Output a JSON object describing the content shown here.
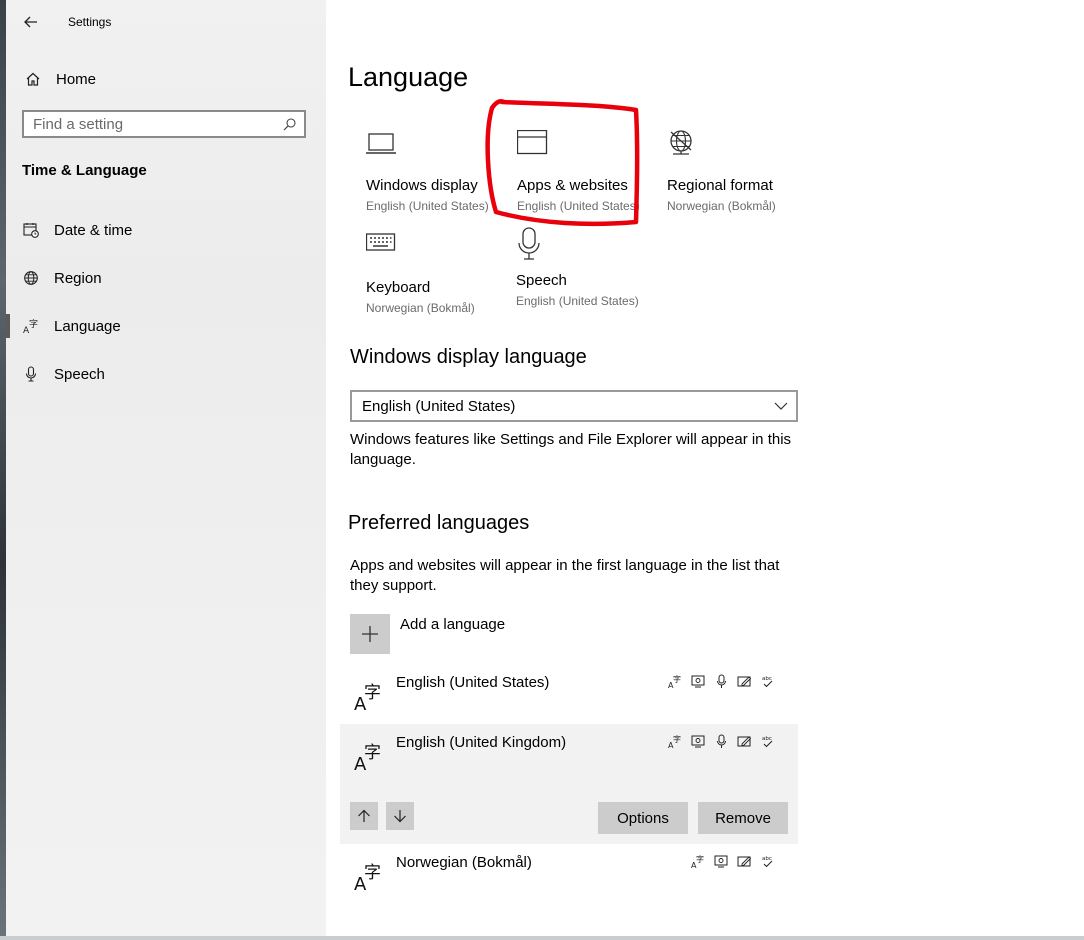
{
  "window": {
    "title": "Settings"
  },
  "sidebar": {
    "home_label": "Home",
    "search_placeholder": "Find a setting",
    "section_title": "Time & Language",
    "items": [
      {
        "label": "Date & time",
        "icon": "calendar-clock-icon"
      },
      {
        "label": "Region",
        "icon": "globe-icon"
      },
      {
        "label": "Language",
        "icon": "language-icon",
        "selected": true
      },
      {
        "label": "Speech",
        "icon": "microphone-icon"
      }
    ]
  },
  "main": {
    "page_title": "Language",
    "tiles": [
      {
        "name": "Windows display",
        "sub": "English (United States)",
        "icon": "monitor-icon"
      },
      {
        "name": "Apps & websites",
        "sub": "English (United States)",
        "icon": "window-icon"
      },
      {
        "name": "Regional format",
        "sub": "Norwegian (Bokmål)",
        "icon": "globe-settings-icon"
      },
      {
        "name": "Keyboard",
        "sub": "Norwegian (Bokmål)",
        "icon": "keyboard-icon"
      },
      {
        "name": "Speech",
        "sub": "English (United States)",
        "icon": "microphone-icon"
      }
    ],
    "display_language": {
      "heading": "Windows display language",
      "selected": "English (United States)",
      "description": "Windows features like Settings and File Explorer will appear in this language."
    },
    "preferred": {
      "heading": "Preferred languages",
      "description": "Apps and websites will appear in the first language in the list that they support.",
      "add_label": "Add a language",
      "languages": [
        {
          "name": "English (United States)"
        },
        {
          "name": "English (United Kingdom)"
        },
        {
          "name": "Norwegian (Bokmål)"
        }
      ],
      "options_label": "Options",
      "remove_label": "Remove"
    }
  },
  "colors": {
    "annotation": "#e8000b",
    "selected_row": "#f2f2f2",
    "button": "#cccccc"
  }
}
